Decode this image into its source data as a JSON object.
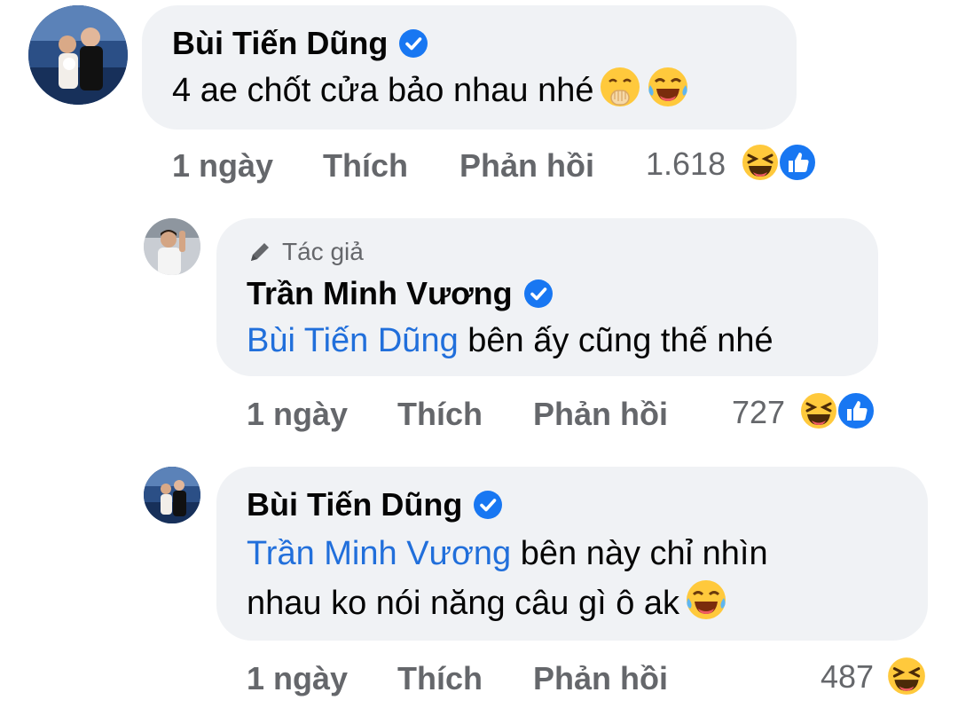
{
  "comments": [
    {
      "author": "Bùi Tiến Dũng",
      "text": "4 ae chốt cửa bảo nhau nhé",
      "time": "1 ngày",
      "like_label": "Thích",
      "reply_label": "Phản hồi",
      "reaction_count": "1.618",
      "reactions": [
        "haha",
        "like"
      ]
    },
    {
      "author_tag": "Tác giả",
      "author": "Trần Minh Vương",
      "mention": "Bùi Tiến Dũng",
      "text": " bên ấy cũng thế nhé",
      "time": "1 ngày",
      "like_label": "Thích",
      "reply_label": "Phản hồi",
      "reaction_count": "727",
      "reactions": [
        "haha",
        "like"
      ]
    },
    {
      "author": "Bùi Tiến Dũng",
      "mention": "Trần Minh Vương",
      "text_line1": " bên này chỉ nhìn",
      "text_line2": "nhau ko nói năng câu gì ô ak",
      "time": "1 ngày",
      "like_label": "Thích",
      "reply_label": "Phản hồi",
      "reaction_count": "487",
      "reactions": [
        "haha"
      ]
    }
  ],
  "colors": {
    "bubble": "#f0f2f5",
    "mention": "#216fdb",
    "meta": "#65676b",
    "verified": "#1877f2"
  }
}
